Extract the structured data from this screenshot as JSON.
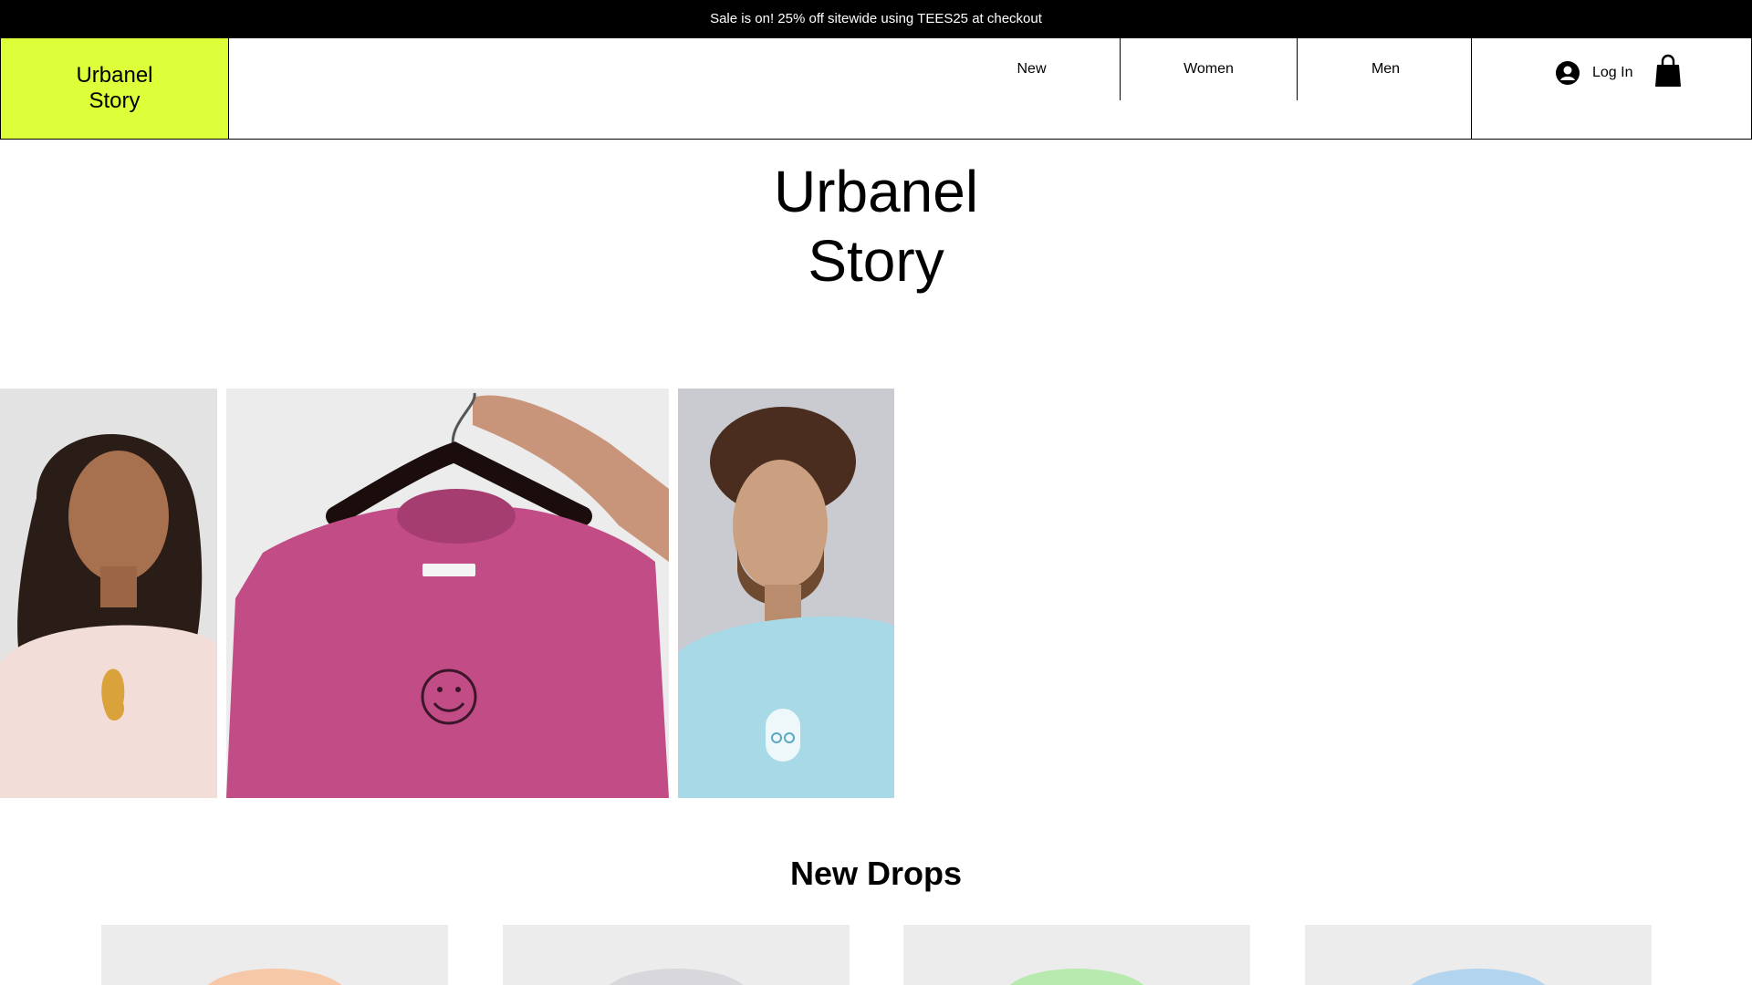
{
  "banner": {
    "text": "Sale is on! 25% off sitewide using TEES25 at checkout",
    "bg": "#000000"
  },
  "header": {
    "logo_line1": "Urbanel",
    "logo_line2": "Story",
    "logo_bg": "#dcff3a",
    "nav": [
      {
        "label": "New"
      },
      {
        "label": "Women"
      },
      {
        "label": "Men"
      }
    ],
    "login_label": "Log In",
    "login_icon": "user-avatar-icon",
    "cart_icon": "shopping-bag-icon"
  },
  "hero": {
    "title_line1": "Urbanel",
    "title_line2": "Story"
  },
  "gallery": [
    {
      "name": "woman-pink-leopard-tee",
      "bg": "#e3e3e3",
      "tee": "#f3ddd8"
    },
    {
      "name": "pink-smiley-tee-on-hanger",
      "bg": "#ececec",
      "tee": "#c24c86"
    },
    {
      "name": "man-blue-bike-tee",
      "bg": "#c9cbd1",
      "tee": "#a7d9e7"
    }
  ],
  "new_drops": {
    "title": "New Drops",
    "cards": [
      {
        "tee_color": "#f7c8a8"
      },
      {
        "tee_color": "#d8d8dc"
      },
      {
        "tee_color": "#b8eab0"
      },
      {
        "tee_color": "#b3d4ee"
      }
    ]
  }
}
